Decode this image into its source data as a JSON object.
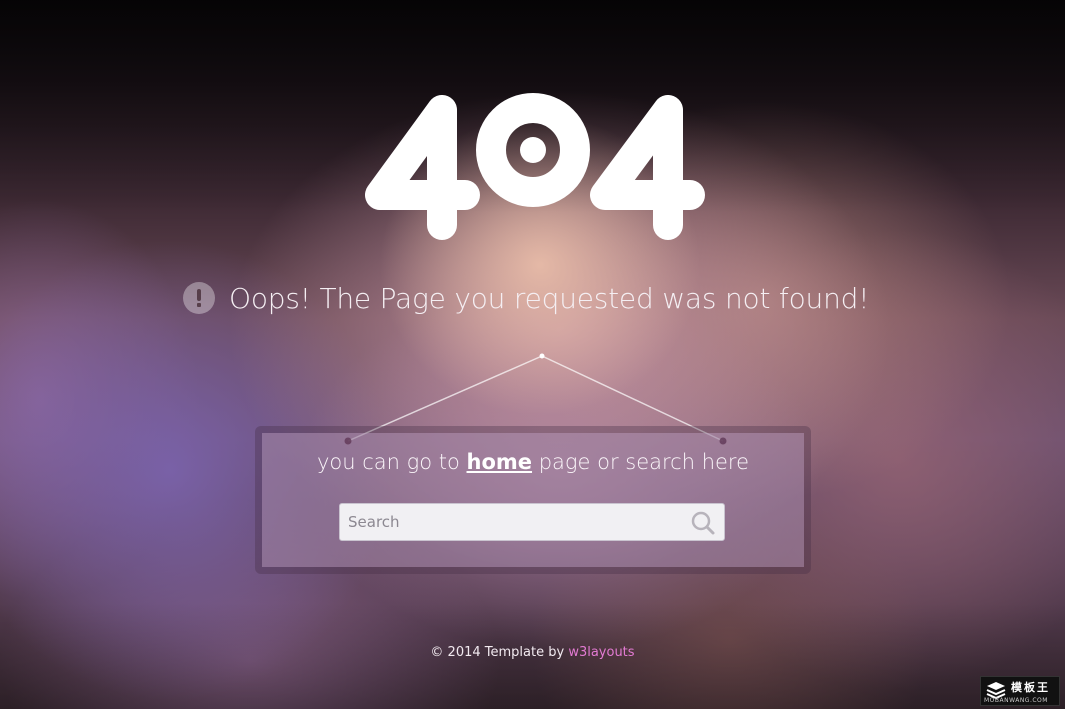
{
  "error": {
    "code": "404",
    "message": "Oops! The Page you requested was not found!"
  },
  "sign": {
    "text_before": "you can go to",
    "home_link": "home",
    "text_after": "page or search here",
    "search": {
      "placeholder": "Search",
      "value": ""
    }
  },
  "footer": {
    "copyright": "© 2014 Template by",
    "author_link": "w3layouts"
  },
  "watermark": {
    "cn_text": "模板王",
    "en_text": "MOBANWANG.COM"
  },
  "colors": {
    "link_accent": "#e27ad2",
    "text": "#ffffff"
  },
  "icons": [
    "exclamation-circle-icon",
    "search-icon",
    "watermark-logo-icon"
  ]
}
